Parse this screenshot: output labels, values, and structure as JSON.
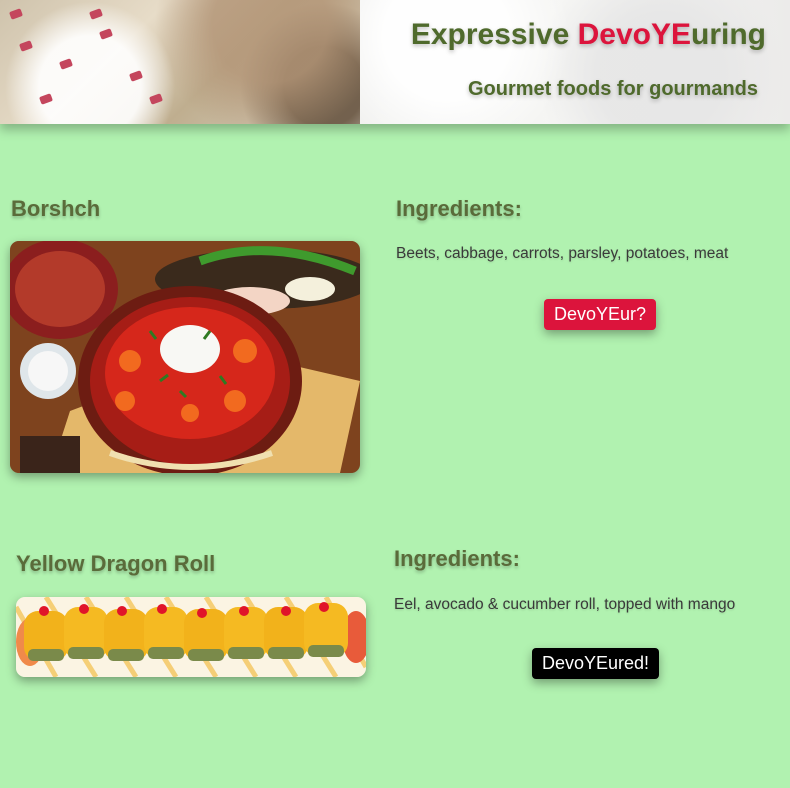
{
  "header": {
    "title_part1": "Expressive ",
    "title_accent": "DevoYE",
    "title_part2": "uring",
    "subtitle": "Gourmet foods for gourmands"
  },
  "dishes": [
    {
      "name": "Borshch",
      "ingredients_heading": "Ingredients:",
      "ingredients": "Beets, cabbage, carrots, parsley, potatoes, meat",
      "button_label": "DevoYEur?"
    },
    {
      "name": "Yellow Dragon Roll",
      "ingredients_heading": "Ingredients:",
      "ingredients": "Eel, avocado & cucumber roll, topped with mango",
      "button_label": "DevoYEured!"
    }
  ],
  "colors": {
    "background": "#b1f2b0",
    "title_green": "#4f6a2c",
    "accent_red": "#dc143c",
    "button_black": "#000000"
  }
}
